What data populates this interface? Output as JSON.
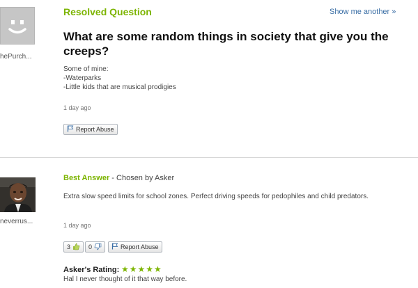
{
  "question": {
    "status_label": "Resolved Question",
    "show_another_label": "Show me another »",
    "asker_name": "hePurch...",
    "title": "What are some random things in society that give you the creeps?",
    "details": [
      "Some of mine:",
      "-Waterparks",
      "-Little kids that are musical prodigies"
    ],
    "timestamp": "1 day ago",
    "report_abuse_label": "Report Abuse"
  },
  "answer": {
    "heading": "Best Answer",
    "chosen_by": " - Chosen by Asker",
    "answerer_name": "neverrus...",
    "text": "Extra slow speed limits for school zones. Perfect driving speeds for pedophiles and child predators.",
    "timestamp": "1 day ago",
    "thumbs_up_count": "3",
    "thumbs_down_count": "0",
    "report_abuse_label": "Report Abuse",
    "rating_label": "Asker's Rating:",
    "rating_stars": "★★★★★",
    "rating": 5,
    "rating_comment": "Hal I never thought of it that way before."
  },
  "colors": {
    "accent_green": "#7cb400",
    "link_blue": "#3a6ea5"
  },
  "icons": [
    "default-avatar-icon",
    "flag-icon",
    "thumbs-up-icon",
    "thumbs-down-icon",
    "star-icon"
  ]
}
